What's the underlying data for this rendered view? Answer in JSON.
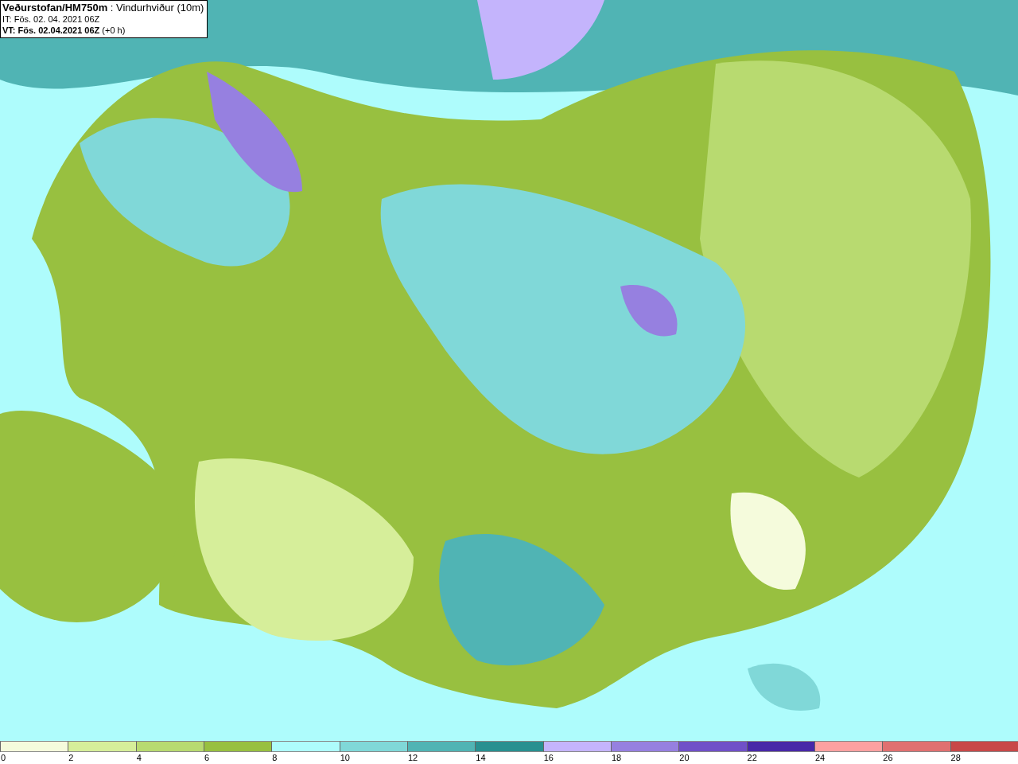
{
  "header": {
    "title": "**Veðurstofan/HM750m** : Vindurhviður (10m)",
    "issue_time": "IT: Fös. 02. 04. 2021 06Z",
    "valid_time": "**VT: Fös. 02.04.2021 06Z** (+0 h)"
  },
  "legend": {
    "bins": [
      {
        "label": "0",
        "color": "#f5fbdc"
      },
      {
        "label": "2",
        "color": "#d6ee9a"
      },
      {
        "label": "4",
        "color": "#b8da70"
      },
      {
        "label": "6",
        "color": "#98c040"
      },
      {
        "label": "8",
        "color": "#aefcfc"
      },
      {
        "label": "10",
        "color": "#80d8d8"
      },
      {
        "label": "12",
        "color": "#50b4b4"
      },
      {
        "label": "14",
        "color": "#289090"
      },
      {
        "label": "16",
        "color": "#c4b4fc"
      },
      {
        "label": "18",
        "color": "#9680e0"
      },
      {
        "label": "20",
        "color": "#7050c8"
      },
      {
        "label": "22",
        "color": "#4828a8"
      },
      {
        "label": "24",
        "color": "#fca0a0"
      },
      {
        "label": "26",
        "color": "#e07070"
      },
      {
        "label": "28",
        "color": "#c84848"
      }
    ]
  }
}
